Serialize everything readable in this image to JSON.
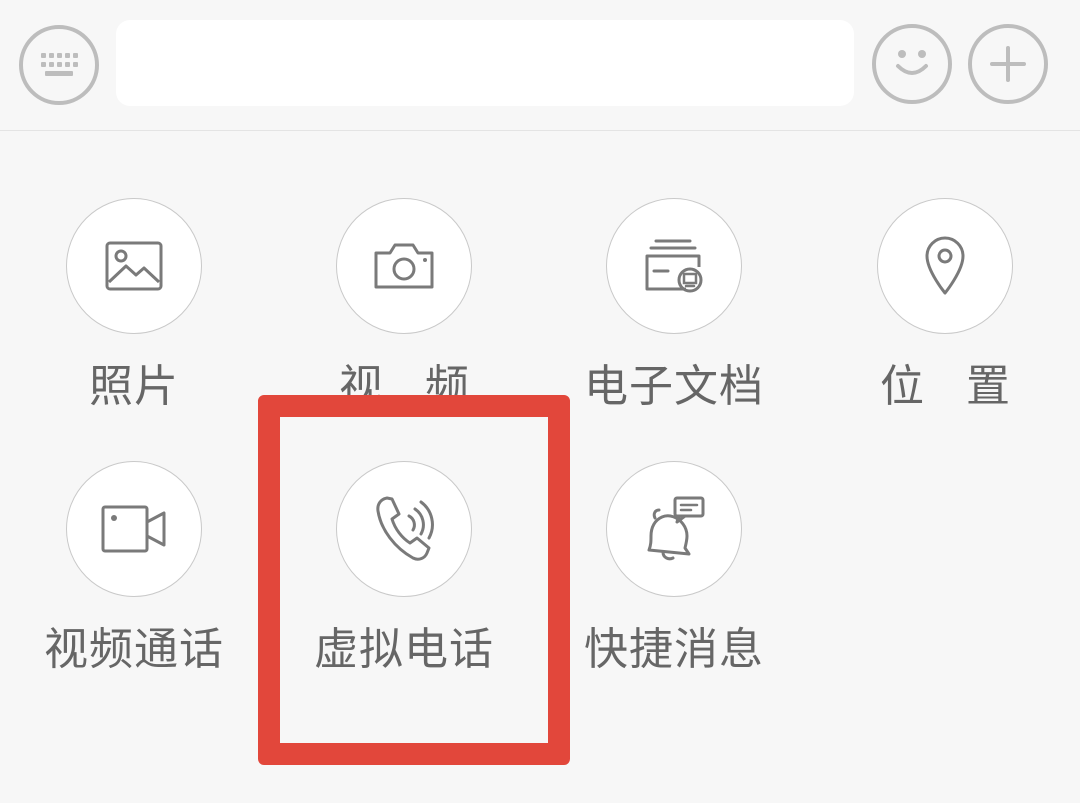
{
  "input_bar": {
    "keyboard_icon": "keyboard-icon",
    "text_value": "",
    "emoji_icon": "smiley-icon",
    "plus_icon": "plus-icon"
  },
  "panel": {
    "items": [
      {
        "label": "照片",
        "icon": "image-icon"
      },
      {
        "label": "视 频",
        "icon": "camera-icon"
      },
      {
        "label": "电子文档",
        "icon": "document-icon"
      },
      {
        "label": "位 置",
        "icon": "location-pin-icon"
      },
      {
        "label": "视频通话",
        "icon": "video-camera-icon"
      },
      {
        "label": "虚拟电话",
        "icon": "phone-call-icon"
      },
      {
        "label": "快捷消息",
        "icon": "bell-message-icon"
      }
    ]
  },
  "annotation": {
    "color": "#e2473b"
  },
  "colors": {
    "background": "#f7f7f7",
    "icon_stroke": "#7a7a7a",
    "label_text": "#666666"
  }
}
